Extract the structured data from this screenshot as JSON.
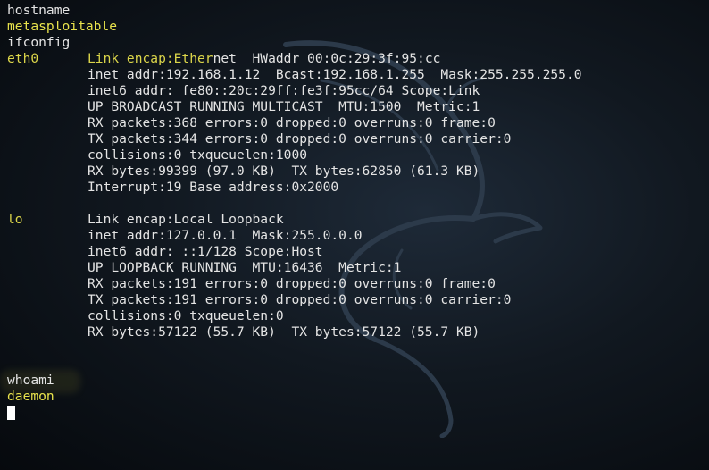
{
  "terminal": {
    "colors": {
      "background": "#111820",
      "text": "#e4e4e4",
      "highlight": "#e8e24c",
      "cursor": "#ffffff"
    },
    "lines": {
      "cmd_hostname": "hostname",
      "out_hostname": "metasploitable",
      "cmd_ifconfig": "ifconfig",
      "cmd_whoami": "whoami",
      "out_whoami": "daemon"
    },
    "interfaces": [
      {
        "name": "eth0",
        "first_line_highlight": "Link encap:Ether",
        "first_line_rest": "net  HWaddr 00:0c:29:3f:95:cc",
        "details": [
          "inet addr:192.168.1.12  Bcast:192.168.1.255  Mask:255.255.255.0",
          "inet6 addr: fe80::20c:29ff:fe3f:95cc/64 Scope:Link",
          "UP BROADCAST RUNNING MULTICAST  MTU:1500  Metric:1",
          "RX packets:368 errors:0 dropped:0 overruns:0 frame:0",
          "TX packets:344 errors:0 dropped:0 overruns:0 carrier:0",
          "collisions:0 txqueuelen:1000",
          "RX bytes:99399 (97.0 KB)  TX bytes:62850 (61.3 KB)",
          "Interrupt:19 Base address:0x2000"
        ]
      },
      {
        "name": "lo",
        "first_line": "Link encap:Local Loopback",
        "details": [
          "inet addr:127.0.0.1  Mask:255.0.0.0",
          "inet6 addr: ::1/128 Scope:Host",
          "UP LOOPBACK RUNNING  MTU:16436  Metric:1",
          "RX packets:191 errors:0 dropped:0 overruns:0 frame:0",
          "TX packets:191 errors:0 dropped:0 overruns:0 carrier:0",
          "collisions:0 txqueuelen:0",
          "RX bytes:57122 (55.7 KB)  TX bytes:57122 (55.7 KB)"
        ]
      }
    ],
    "background_art": "kali-dragon-icon"
  }
}
